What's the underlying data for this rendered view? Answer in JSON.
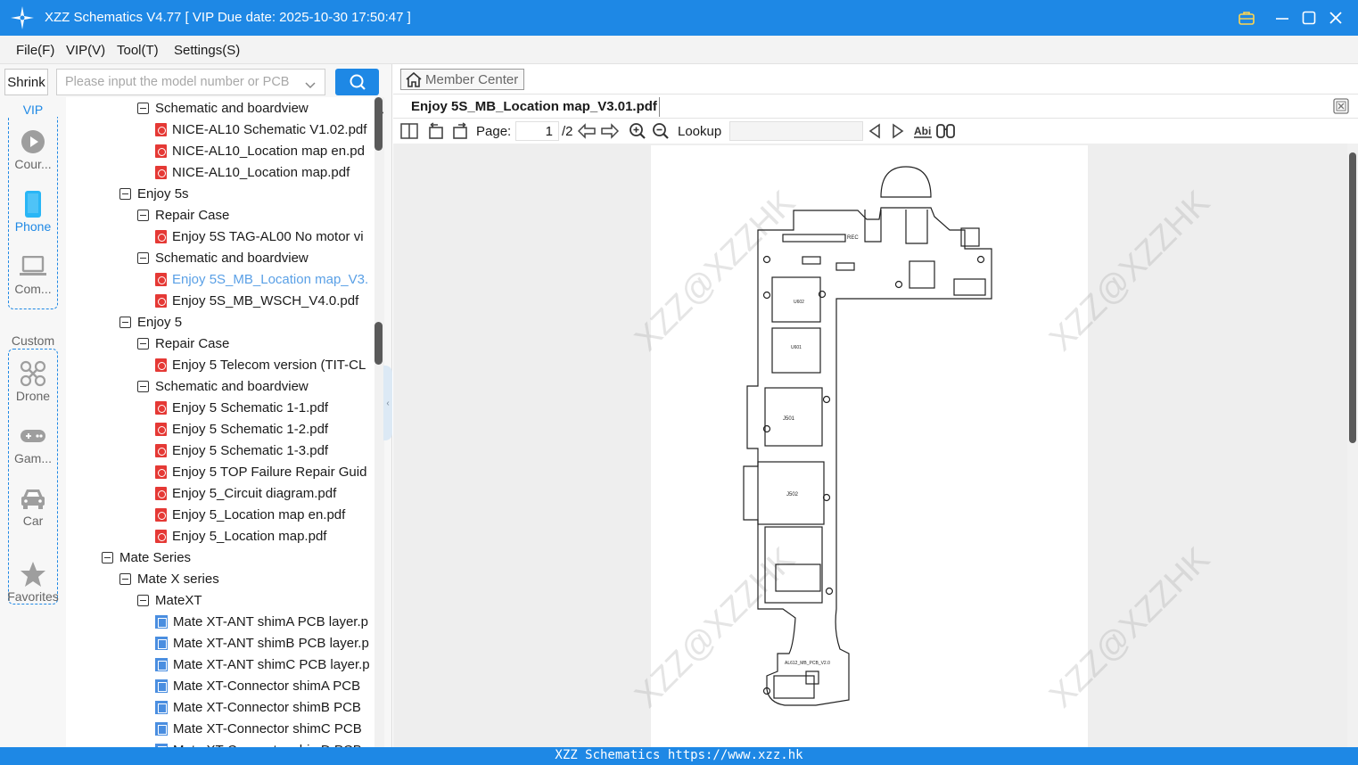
{
  "window": {
    "title": "XZZ Schematics V4.77 [ VIP Due date: 2025-10-30 17:50:47 ]",
    "accent_color": "#1e88e5",
    "controls": [
      "briefcase-icon",
      "minimize-icon",
      "maximize-icon",
      "close-icon"
    ]
  },
  "menu": {
    "file": "File(F)",
    "vip": "VIP(V)",
    "tool": "Tool(T)",
    "settings": "Settings(S)"
  },
  "sidebar": {
    "shrink_label": "Shrink",
    "search_placeholder": "Please input the model number or PCB",
    "vip_group_title": "VIP",
    "custom_group_title": "Custom",
    "rail": {
      "course": "Cour...",
      "phone": "Phone",
      "computer": "Com...",
      "drone": "Drone",
      "game": "Gam...",
      "car": "Car",
      "favorites": "Favorites"
    },
    "selected_rail": "Phone"
  },
  "tree": [
    {
      "label": "Schematic and boardview",
      "type": "folder"
    },
    {
      "label": "NICE-AL10 Schematic V1.02.pdf",
      "type": "pdf"
    },
    {
      "label": "NICE-AL10_Location map en.pd",
      "type": "pdf"
    },
    {
      "label": "NICE-AL10_Location map.pdf",
      "type": "pdf"
    },
    {
      "label": "Enjoy 5s",
      "type": "folder"
    },
    {
      "label": "Repair Case",
      "type": "folder"
    },
    {
      "label": "Enjoy 5S TAG-AL00 No motor vi",
      "type": "pdf"
    },
    {
      "label": "Schematic and boardview",
      "type": "folder"
    },
    {
      "label": "Enjoy 5S_MB_Location map_V3.",
      "type": "pdf",
      "selected": true
    },
    {
      "label": "Enjoy 5S_MB_WSCH_V4.0.pdf",
      "type": "pdf"
    },
    {
      "label": "Enjoy 5",
      "type": "folder"
    },
    {
      "label": "Repair Case",
      "type": "folder"
    },
    {
      "label": "Enjoy 5 Telecom version (TIT-CL",
      "type": "pdf"
    },
    {
      "label": "Schematic and boardview",
      "type": "folder"
    },
    {
      "label": "Enjoy 5 Schematic 1-1.pdf",
      "type": "pdf"
    },
    {
      "label": "Enjoy 5 Schematic 1-2.pdf",
      "type": "pdf"
    },
    {
      "label": "Enjoy 5 Schematic 1-3.pdf",
      "type": "pdf"
    },
    {
      "label": "Enjoy 5 TOP Failure Repair Guid",
      "type": "pdf"
    },
    {
      "label": "Enjoy 5_Circuit diagram.pdf",
      "type": "pdf"
    },
    {
      "label": "Enjoy 5_Location map en.pdf",
      "type": "pdf"
    },
    {
      "label": "Enjoy 5_Location map.pdf",
      "type": "pdf"
    },
    {
      "label": "Mate Series",
      "type": "folder"
    },
    {
      "label": "Mate X series",
      "type": "folder"
    },
    {
      "label": "MateXT",
      "type": "folder"
    },
    {
      "label": "Mate XT-ANT shimA PCB layer.p",
      "type": "pcb"
    },
    {
      "label": "Mate XT-ANT shimB PCB layer.p",
      "type": "pcb"
    },
    {
      "label": "Mate XT-ANT shimC PCB layer.p",
      "type": "pcb"
    },
    {
      "label": "Mate XT-Connector shimA PCB",
      "type": "pcb"
    },
    {
      "label": "Mate XT-Connector shimB PCB",
      "type": "pcb"
    },
    {
      "label": "Mate XT-Connector shimC PCB",
      "type": "pcb"
    },
    {
      "label": "Mate XT-Connector shimD PCB",
      "type": "pcb"
    }
  ],
  "viewer": {
    "member_center": "Member Center",
    "tab_title": "Enjoy 5S_MB_Location map_V3.01.pdf",
    "page_label": "Page:",
    "page_current": "1",
    "page_total": "/2",
    "lookup_label": "Lookup",
    "lookup_value": "",
    "watermark": "XZZ@XZZHK",
    "board": {
      "label_rec": "REC",
      "label_u602": "U602",
      "label_u601": "U601",
      "label_j501": "J501",
      "label_j502": "J502",
      "label_pcb": "AL612_MB_PCB_V2.0"
    }
  },
  "status": {
    "text": "XZZ Schematics https://www.xzz.hk"
  }
}
